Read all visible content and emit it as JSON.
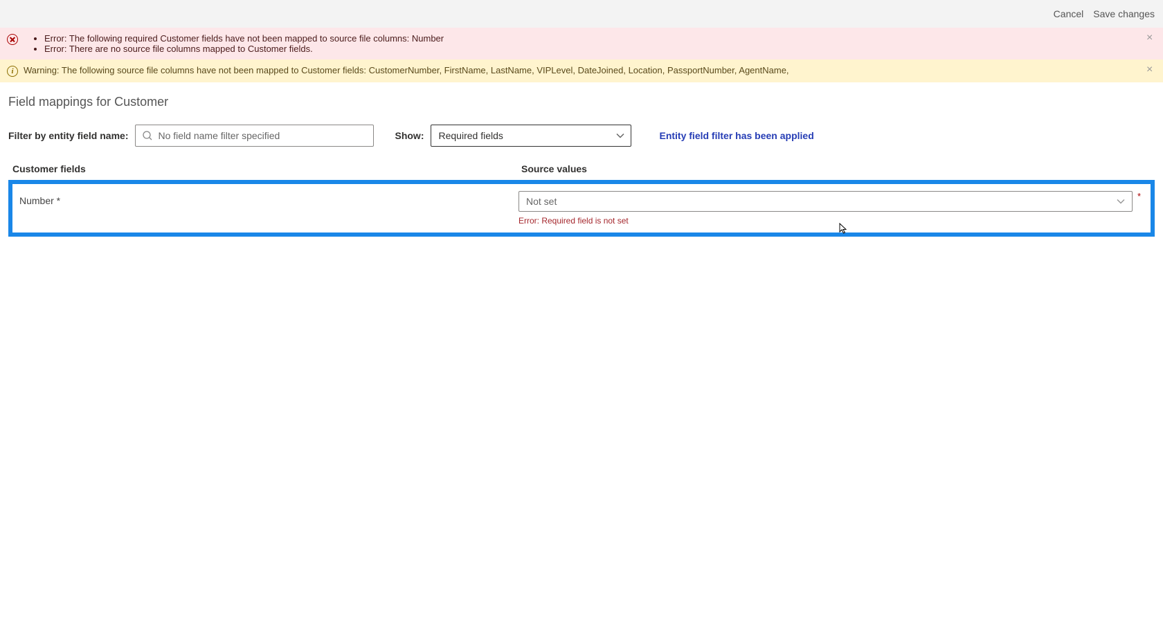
{
  "topbar": {
    "cancel": "Cancel",
    "save": "Save changes"
  },
  "alerts": {
    "error": {
      "items": [
        "Error: The following required Customer fields have not been mapped to source file columns: Number",
        "Error: There are no source file columns mapped to Customer fields."
      ]
    },
    "warning": {
      "text": "Warning: The following source file columns have not been mapped to Customer fields: CustomerNumber, FirstName, LastName, VIPLevel, DateJoined, Location, PassportNumber, AgentName,"
    }
  },
  "page": {
    "title": "Field mappings for Customer"
  },
  "filter": {
    "label": "Filter by entity field name:",
    "placeholder": "No field name filter specified",
    "show_label": "Show:",
    "show_value": "Required fields",
    "applied": "Entity field filter has been applied"
  },
  "table": {
    "header_fields": "Customer fields",
    "header_source": "Source values"
  },
  "row": {
    "field_name": "Number *",
    "source_value": "Not set",
    "error": "Error: Required field is not set"
  }
}
